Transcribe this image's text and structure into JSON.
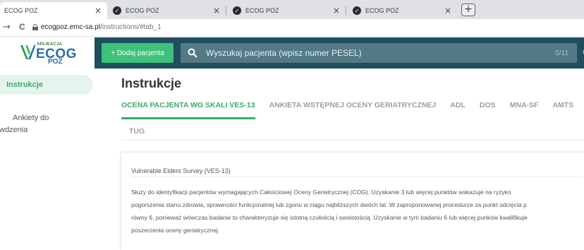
{
  "browser": {
    "tabs": [
      {
        "title": "ECOG POZ",
        "close": "×"
      },
      {
        "title": "ECOG POZ",
        "close": "×"
      },
      {
        "title": "ECOG POZ",
        "close": "×"
      },
      {
        "title": "ECOG POZ",
        "close": "×"
      }
    ],
    "new_tab": "+",
    "back": "←",
    "forward": "→",
    "reload": "C",
    "url_host": "ecogpoz.emc-sa.pl",
    "url_path": "/instructions/#tab_1"
  },
  "logo": {
    "small": "APLIKACJA",
    "main": "ECOG",
    "sub": "POZ"
  },
  "header": {
    "add_patient": "+ Dodaj pacjenta",
    "search_placeholder": "Wyszukaj pacjenta (wpisz numer PESEL)",
    "search_count": "0/11",
    "edge_text": "C"
  },
  "sidebar": {
    "items": [
      {
        "label": "Instrukcje",
        "active": true
      },
      {
        "line1": "Ankiety do",
        "line2": "wdzenia"
      }
    ]
  },
  "main": {
    "title": "Instrukcje",
    "tabs": [
      {
        "label": "OCENA PACJENTA WG SKALI VES-13",
        "active": true
      },
      {
        "label": "ANKIETA WSTĘPNEJ OCENY GERIATRYCZNEJ"
      },
      {
        "label": "ADL"
      },
      {
        "label": "DOS"
      },
      {
        "label": "MNA-SF"
      },
      {
        "label": "AMTS"
      },
      {
        "label": "TUG"
      }
    ],
    "card": {
      "title": "Vulnerable Elders Survey (VES-13)",
      "lines": [
        "Służy do identyfikacji pacjentów wymagających Całościowej Oceny Geriatrycznej (COG). Uzyskanie 3 lub więcej punktów wskazuje na ryzyko",
        "pogorszenia stanu zdrowia, sprawności funkcjonalnej lub zgonu w ciągu najbliższych dwóch lat. W zaproponowanej procedurze za punkt odcięcia p",
        "równy 6, ponieważ wówczas badanie to charakteryzuje się istotną czułością i swoistością. Uzyskanie w tym badaniu 6 lub więcej punków kwalifikuje",
        "poszerzenia oceny geriatrycznej."
      ]
    }
  },
  "colors": {
    "accent_green": "#3aaa6c",
    "topbar": "#1f4e5f",
    "search_bg": "#537985",
    "button_green": "#3ec17a",
    "logo_blue": "#2b6ea6"
  }
}
